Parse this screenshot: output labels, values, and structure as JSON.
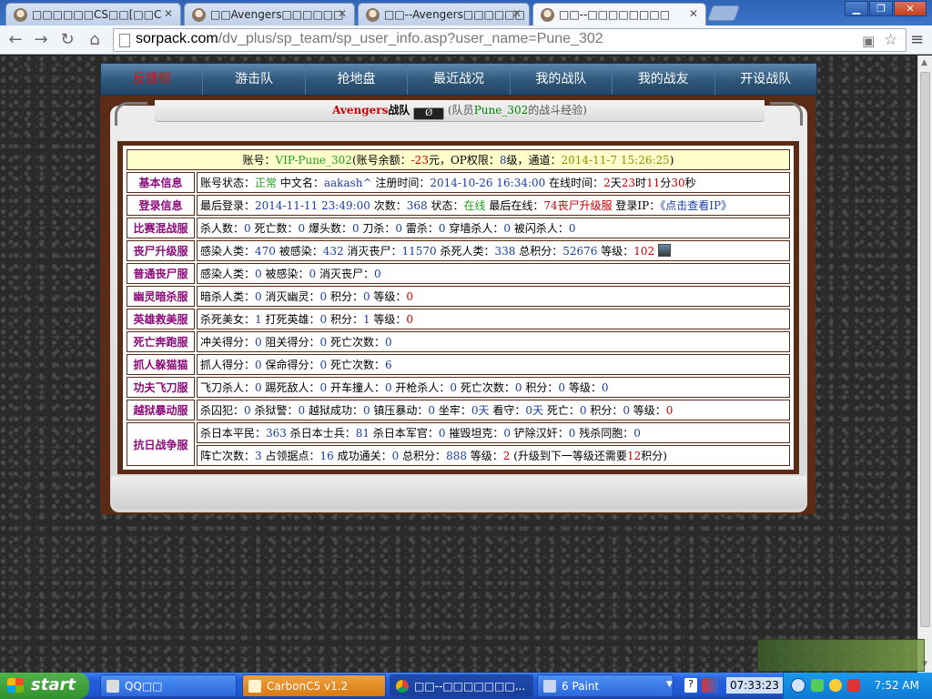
{
  "browser": {
    "tabs": [
      {
        "label": "□□□□□□CS□□[□□C"
      },
      {
        "label": "□□Avengers□□□□□□"
      },
      {
        "label": "□□--Avengers□□□□□□"
      },
      {
        "label": "□□--□□□□□□□□"
      }
    ],
    "url_host": "sorpack.com",
    "url_path": "/dv_plus/sp_team/sp_user_info.asp?user_name=Pune_302"
  },
  "nav": {
    "items": [
      "反馈帮",
      "游击队",
      "抢地盘",
      "最近战况",
      "我的战队",
      "我的战友",
      "开设战队"
    ]
  },
  "title": {
    "team": "Avengers",
    "team_suffix": "战队",
    "member_prefix": "(队员",
    "member": "Pune_302",
    "member_suffix": "的战斗经验)"
  },
  "account": {
    "l1": "账号：",
    "id": "VIP-Pune_302",
    "l2": "(账号余额：",
    "balance": "-23",
    "l3": "元，OP权限：",
    "op": "8",
    "l4": "级，通道：",
    "channel": "2014-11-7 15:26:25",
    "l5": ")"
  },
  "rows": {
    "basic": {
      "cat": "基本信息",
      "l1": "账号状态：",
      "status": "正常",
      "l2": " 中文名：",
      "cname": "aakash^",
      "l3": " 注册时间：",
      "reg": "2014-10-26 16:34:00",
      "l4": " 在线时间：",
      "d": "2",
      "l5": "天",
      "h": "23",
      "l6": "时",
      "m": "11",
      "l7": "分",
      "s": "30",
      "l8": "秒"
    },
    "login": {
      "cat": "登录信息",
      "l1": "最后登录：",
      "last": "2014-11-11 23:49:00",
      "l2": " 次数：",
      "count": "368",
      "l3": " 状态：",
      "state": "在线",
      "l4": " 最后在线：",
      "where": "74丧尸升级服",
      "l5": " 登录IP：",
      "ip": "《点击查看IP》"
    },
    "mixed": {
      "cat": "比赛混战服",
      "l1": "杀人数：",
      "v1": "0",
      "l2": " 死亡数：",
      "v2": "0",
      "l3": " 爆头数：",
      "v3": "0",
      "l4": " 刀杀：",
      "v4": "0",
      "l5": " 雷杀：",
      "v5": "0",
      "l6": " 穿墙杀人：",
      "v6": "0",
      "l7": " 被闪杀人：",
      "v7": "0"
    },
    "zombie_up": {
      "cat": "丧尸升级服",
      "l1": "感染人类：",
      "v1": "470",
      "l2": " 被感染：",
      "v2": "432",
      "l3": " 消灭丧尸：",
      "v3": "11570",
      "l4": " 杀死人类：",
      "v4": "338",
      "l5": " 总积分：",
      "v5": "52676",
      "l6": " 等级：",
      "v6": "102"
    },
    "zombie": {
      "cat": "普通丧尸服",
      "l1": "感染人类：",
      "v1": "0",
      "l2": " 被感染：",
      "v2": "0",
      "l3": " 消灭丧尸：",
      "v3": "0"
    },
    "ghost": {
      "cat": "幽灵暗杀服",
      "l1": "暗杀人类：",
      "v1": "0",
      "l2": " 消灭幽灵：",
      "v2": "0",
      "l3": " 积分：",
      "v3": "0",
      "l4": " 等级：",
      "v4": "0"
    },
    "hero": {
      "cat": "英雄救美服",
      "l1": "杀死美女：",
      "v1": "1",
      "l2": " 打死英雄：",
      "v2": "0",
      "l3": " 积分：",
      "v3": "1",
      "l4": " 等级：",
      "v4": "0"
    },
    "death": {
      "cat": "死亡奔跑服",
      "l1": "冲关得分：",
      "v1": "0",
      "l2": " 阻关得分：",
      "v2": "0",
      "l3": " 死亡次数：",
      "v3": "0"
    },
    "hide": {
      "cat": "抓人躲猫猫",
      "l1": "抓人得分：",
      "v1": "0",
      "l2": " 保命得分：",
      "v2": "0",
      "l3": " 死亡次数：",
      "v3": "6"
    },
    "kungfu": {
      "cat": "功夫飞刀服",
      "l1": "飞刀杀人：",
      "v1": "0",
      "l2": " 踢死敌人：",
      "v2": "0",
      "l3": " 开车撞人：",
      "v3": "0",
      "l4": " 开枪杀人：",
      "v4": "0",
      "l5": " 死亡次数：",
      "v5": "0",
      "l6": " 积分：",
      "v6": "0",
      "l7": " 等级：",
      "v7": "0"
    },
    "prison": {
      "cat": "越狱暴动服",
      "l1": "杀囚犯：",
      "v1": "0",
      "l2": " 杀狱警：",
      "v2": "0",
      "l3": " 越狱成功：",
      "v3": "0",
      "l4": " 镇压暴动：",
      "v4": "0",
      "l5": " 坐牢：",
      "v5": "0",
      "l6": "天",
      "l7": " 看守：",
      "v7": "0",
      "l8": "天",
      "l9": " 死亡：",
      "v9": "0",
      "l10": " 积分：",
      "v10": "0",
      "l11": " 等级：",
      "v11": "0"
    },
    "war": {
      "cat": "抗日战争服",
      "a_l1": "杀日本平民：",
      "a_v1": "363",
      "a_l2": " 杀日本士兵：",
      "a_v2": "81",
      "a_l3": " 杀日本军官：",
      "a_v3": "0",
      "a_l4": " 摧毁坦克：",
      "a_v4": "0",
      "a_l5": " 铲除汉奸：",
      "a_v5": "0",
      "a_l6": " 残杀同胞：",
      "a_v6": "0",
      "b_l1": "阵亡次数：",
      "b_v1": "3",
      "b_l2": " 占领据点：",
      "b_v2": "16",
      "b_l3": " 成功通关：",
      "b_v3": "0",
      "b_l4": " 总积分：",
      "b_v4": "888",
      "b_l5": " 等级：",
      "b_v5": "2",
      "b_l6": " (升级到下一等级还需要",
      "b_v6": "12",
      "b_l7": "积分)"
    }
  },
  "taskbar": {
    "start": "start",
    "tasks": [
      "QQ□□",
      "CarbonC5 v1.2",
      "□□--□□□□□□□...",
      "6 Paint"
    ],
    "quick_clock": "07:33:23",
    "clock": "7:52 AM"
  },
  "colors": {
    "accent_red": "#cc0000",
    "value_blue": "#1a3fa3",
    "frame_brown": "#5a2c16"
  }
}
